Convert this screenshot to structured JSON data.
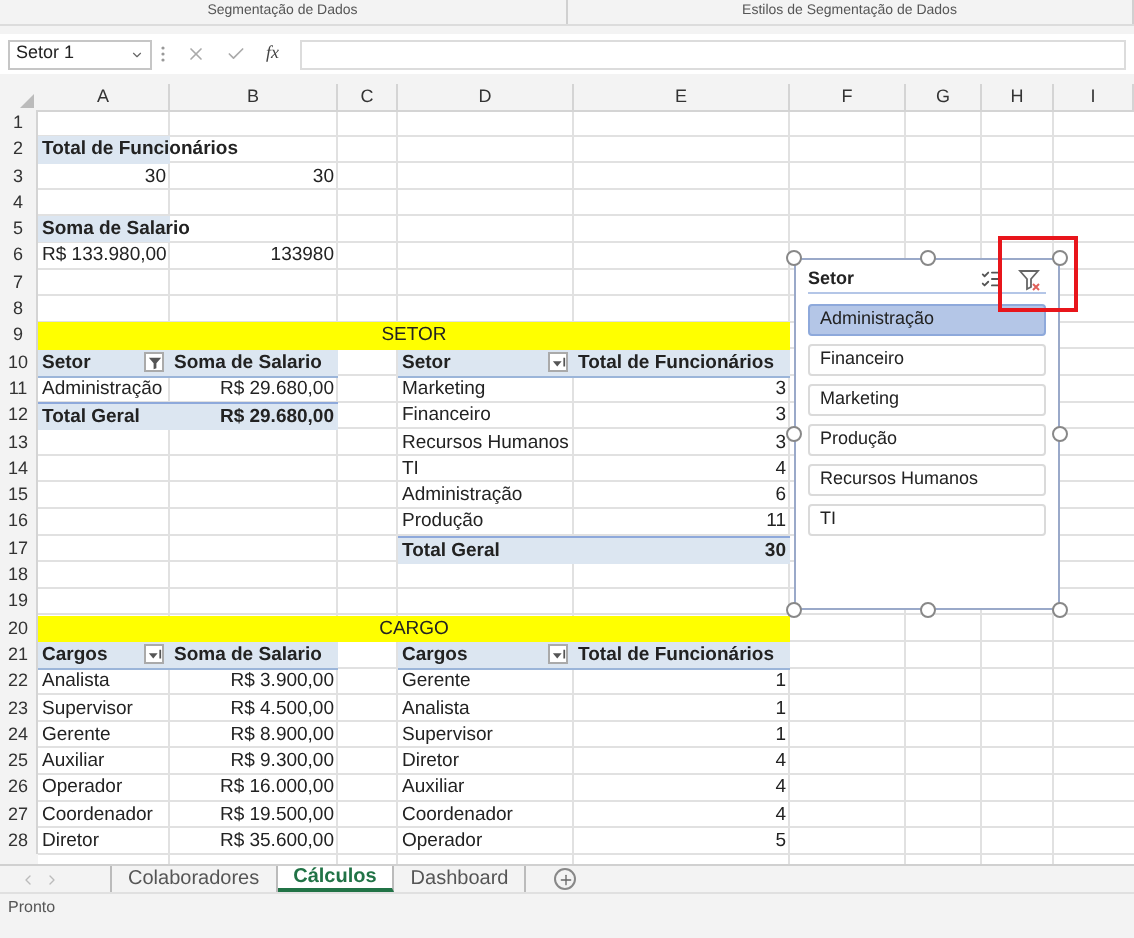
{
  "ribbon": {
    "groups": [
      "Segmentação de Dados",
      "Estilos de Segmentação de Dados"
    ]
  },
  "formula_bar": {
    "name_box": "Setor 1",
    "function_label": "fx"
  },
  "columns": [
    "A",
    "B",
    "C",
    "D",
    "E",
    "F",
    "G",
    "H",
    "I"
  ],
  "rows": [
    {
      "number": "1"
    },
    {
      "number": "2",
      "A": {
        "text": "Total de Funcionários",
        "kind": "field"
      }
    },
    {
      "number": "3",
      "A": {
        "text": "30",
        "kind": "number"
      },
      "B": {
        "text": "30",
        "kind": "number"
      }
    },
    {
      "number": "4"
    },
    {
      "number": "5",
      "A": {
        "text": "Soma de Salario",
        "kind": "field"
      }
    },
    {
      "number": "6",
      "A": {
        "text": "R$ 133.980,00",
        "kind": "number"
      },
      "B": {
        "text": "133980",
        "kind": "number"
      }
    },
    {
      "number": "7"
    },
    {
      "number": "8"
    },
    {
      "number": "9",
      "A": {
        "text": "SETOR",
        "kind": "banner"
      }
    },
    {
      "number": "10",
      "A": {
        "text": "Setor",
        "kind": "filterheader"
      },
      "B": {
        "text": "Soma de Salario",
        "kind": "header"
      },
      "D": {
        "text": "Setor",
        "kind": "sortheader"
      },
      "E": {
        "text": "Total de Funcionários",
        "kind": "header"
      }
    },
    {
      "number": "11",
      "A": {
        "text": "Administração",
        "kind": "label"
      },
      "B": {
        "text": "R$ 29.680,00",
        "kind": "number"
      },
      "D": {
        "text": "Marketing",
        "kind": "label"
      },
      "E": {
        "text": "3",
        "kind": "number"
      }
    },
    {
      "number": "12",
      "A": {
        "text": "Total Geral",
        "kind": "total"
      },
      "B": {
        "text": "R$ 29.680,00",
        "kind": "totalnumber"
      },
      "D": {
        "text": "Financeiro",
        "kind": "label"
      },
      "E": {
        "text": "3",
        "kind": "number"
      }
    },
    {
      "number": "13",
      "D": {
        "text": "Recursos Humanos",
        "kind": "label"
      },
      "E": {
        "text": "3",
        "kind": "number"
      }
    },
    {
      "number": "14",
      "D": {
        "text": "TI",
        "kind": "label"
      },
      "E": {
        "text": "4",
        "kind": "number"
      }
    },
    {
      "number": "15",
      "D": {
        "text": "Administração",
        "kind": "label"
      },
      "E": {
        "text": "6",
        "kind": "number"
      }
    },
    {
      "number": "16",
      "D": {
        "text": "Produção",
        "kind": "label"
      },
      "E": {
        "text": "11",
        "kind": "number"
      }
    },
    {
      "number": "17",
      "D": {
        "text": "Total Geral",
        "kind": "total"
      },
      "E": {
        "text": "30",
        "kind": "totalnumber"
      }
    },
    {
      "number": "18"
    },
    {
      "number": "19"
    },
    {
      "number": "20",
      "A": {
        "text": "CARGO",
        "kind": "banner"
      }
    },
    {
      "number": "21",
      "A": {
        "text": "Cargos",
        "kind": "sortheader"
      },
      "B": {
        "text": "Soma de Salario",
        "kind": "header"
      },
      "D": {
        "text": "Cargos",
        "kind": "sortheader"
      },
      "E": {
        "text": "Total de Funcionários",
        "kind": "header"
      }
    },
    {
      "number": "22",
      "A": {
        "text": "Analista",
        "kind": "label"
      },
      "B": {
        "text": "R$ 3.900,00",
        "kind": "number"
      },
      "D": {
        "text": "Gerente",
        "kind": "label"
      },
      "E": {
        "text": "1",
        "kind": "number"
      }
    },
    {
      "number": "23",
      "A": {
        "text": "Supervisor",
        "kind": "label"
      },
      "B": {
        "text": "R$ 4.500,00",
        "kind": "number"
      },
      "D": {
        "text": "Analista",
        "kind": "label"
      },
      "E": {
        "text": "1",
        "kind": "number"
      }
    },
    {
      "number": "24",
      "A": {
        "text": "Gerente",
        "kind": "label"
      },
      "B": {
        "text": "R$ 8.900,00",
        "kind": "number"
      },
      "D": {
        "text": "Supervisor",
        "kind": "label"
      },
      "E": {
        "text": "1",
        "kind": "number"
      }
    },
    {
      "number": "25",
      "A": {
        "text": "Auxiliar",
        "kind": "label"
      },
      "B": {
        "text": "R$ 9.300,00",
        "kind": "number"
      },
      "D": {
        "text": "Diretor",
        "kind": "label"
      },
      "E": {
        "text": "4",
        "kind": "number"
      }
    },
    {
      "number": "26",
      "A": {
        "text": "Operador",
        "kind": "label"
      },
      "B": {
        "text": "R$ 16.000,00",
        "kind": "number"
      },
      "D": {
        "text": "Auxiliar",
        "kind": "label"
      },
      "E": {
        "text": "4",
        "kind": "number"
      }
    },
    {
      "number": "27",
      "A": {
        "text": "Coordenador",
        "kind": "label"
      },
      "B": {
        "text": "R$ 19.500,00",
        "kind": "number"
      },
      "D": {
        "text": "Coordenador",
        "kind": "label"
      },
      "E": {
        "text": "4",
        "kind": "number"
      }
    },
    {
      "number": "28",
      "A": {
        "text": "Diretor",
        "kind": "label"
      },
      "B": {
        "text": "R$ 35.600,00",
        "kind": "number"
      },
      "D": {
        "text": "Operador",
        "kind": "label"
      },
      "E": {
        "text": "5",
        "kind": "number"
      }
    }
  ],
  "slicer": {
    "title": "Setor",
    "items": [
      {
        "label": "Administração",
        "selected": true
      },
      {
        "label": "Financeiro",
        "selected": false
      },
      {
        "label": "Marketing",
        "selected": false
      },
      {
        "label": "Produção",
        "selected": false
      },
      {
        "label": "Recursos Humanos",
        "selected": false
      },
      {
        "label": "TI",
        "selected": false
      }
    ]
  },
  "sheet_tabs": [
    {
      "label": "Colaboradores",
      "selected": false
    },
    {
      "label": "Cálculos",
      "selected": true
    },
    {
      "label": "Dashboard",
      "selected": false
    }
  ],
  "status_bar": {
    "text": "Pronto"
  }
}
